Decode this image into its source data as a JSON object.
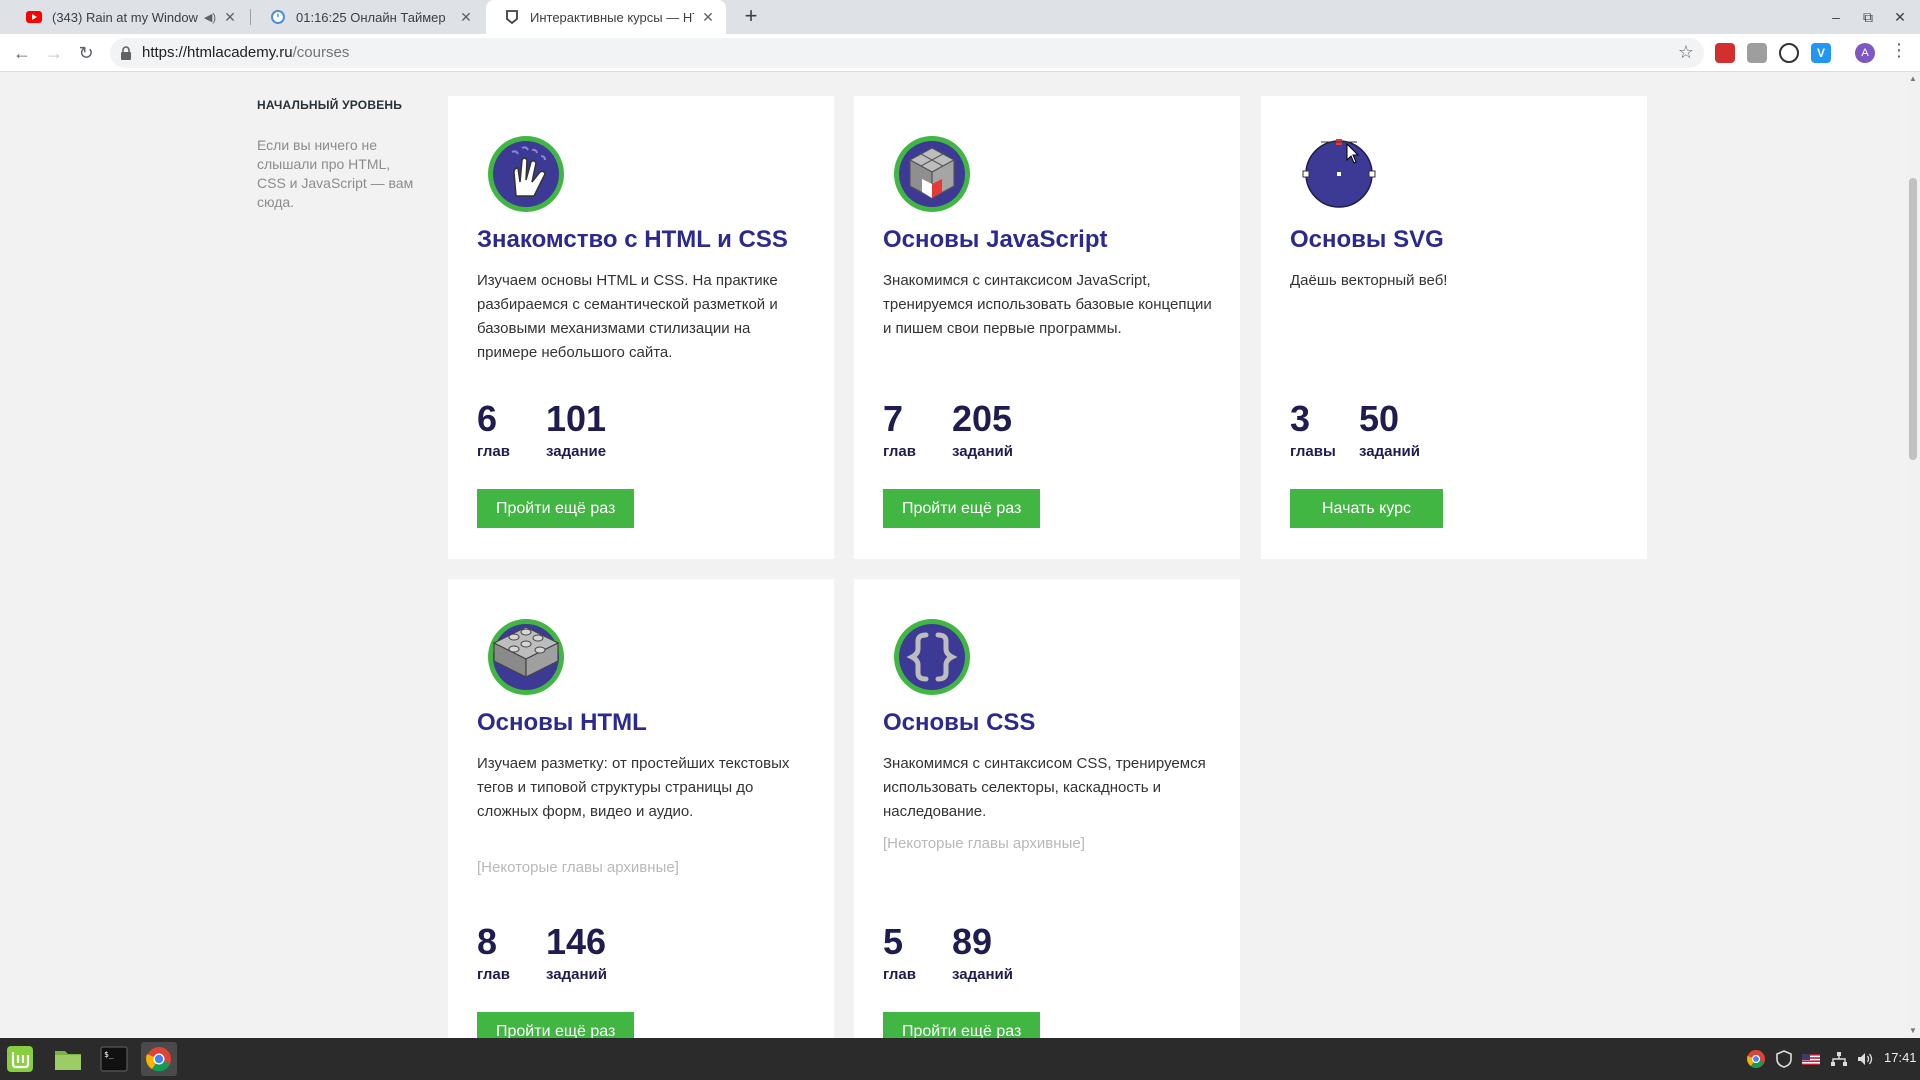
{
  "browser": {
    "tabs": [
      {
        "title": "(343) Rain at my Window",
        "favicon": "youtube-icon",
        "muted_indicator": "speaker-icon"
      },
      {
        "title": "01:16:25 Онлайн Таймер",
        "favicon": "timer-icon"
      },
      {
        "title": "Интерактивные курсы — HT",
        "favicon": "htmlacademy-icon",
        "active": true
      }
    ],
    "url_host": "https://htmlacademy.ru",
    "url_path": "/courses",
    "avatar_letter": "A"
  },
  "sidebar": {
    "heading": "НАЧАЛЬНЫЙ УРОВЕНЬ",
    "text": "Если вы ничего не слышали про HTML, CSS и JavaScript — вам сюда."
  },
  "courses": [
    {
      "title": "Знакомство с HTML и CSS",
      "icon": "hand-icon",
      "description": "Изучаем основы HTML и CSS. На практике разбираемся с семантической разметкой и базовыми механизмами стилизации на примере небольшого сайта.",
      "archive": "",
      "chapters": "6",
      "chapters_label": "глав",
      "tasks": "101",
      "tasks_label": "задание",
      "button": "Пройти ещё раз"
    },
    {
      "title": "Основы JavaScript",
      "icon": "rubiks-cube-icon",
      "description": "Знакомимся с синтаксисом JavaScript, тренируемся использовать базовые концепции и пишем свои первые программы.",
      "archive": "",
      "chapters": "7",
      "chapters_label": "глав",
      "tasks": "205",
      "tasks_label": "заданий",
      "button": "Пройти ещё раз"
    },
    {
      "title": "Основы SVG",
      "icon": "vector-circle-icon",
      "description": "Даёшь векторный веб!",
      "archive": "",
      "chapters": "3",
      "chapters_label": "главы",
      "tasks": "50",
      "tasks_label": "заданий",
      "button": "Начать курс"
    },
    {
      "title": "Основы HTML",
      "icon": "lego-brick-icon",
      "description": "Изучаем разметку: от простейших текстовых тегов и типовой структуры страницы до сложных форм, видео и аудио.",
      "archive": "[Некоторые главы архивные]",
      "chapters": "8",
      "chapters_label": "глав",
      "tasks": "146",
      "tasks_label": "заданий",
      "button": "Пройти ещё раз"
    },
    {
      "title": "Основы CSS",
      "icon": "curly-braces-icon",
      "description": "Знакомимся с синтаксисом CSS, тренируемся использовать селекторы, каскадность и наследование.",
      "archive": "[Некоторые главы архивные]",
      "chapters": "5",
      "chapters_label": "глав",
      "tasks": "89",
      "tasks_label": "заданий",
      "button": "Пройти ещё раз"
    }
  ],
  "taskbar": {
    "clock": "17:41"
  },
  "colors": {
    "accent_green": "#42b642",
    "title_blue": "#2d2a8f",
    "icon_purple": "#3c3a95"
  }
}
